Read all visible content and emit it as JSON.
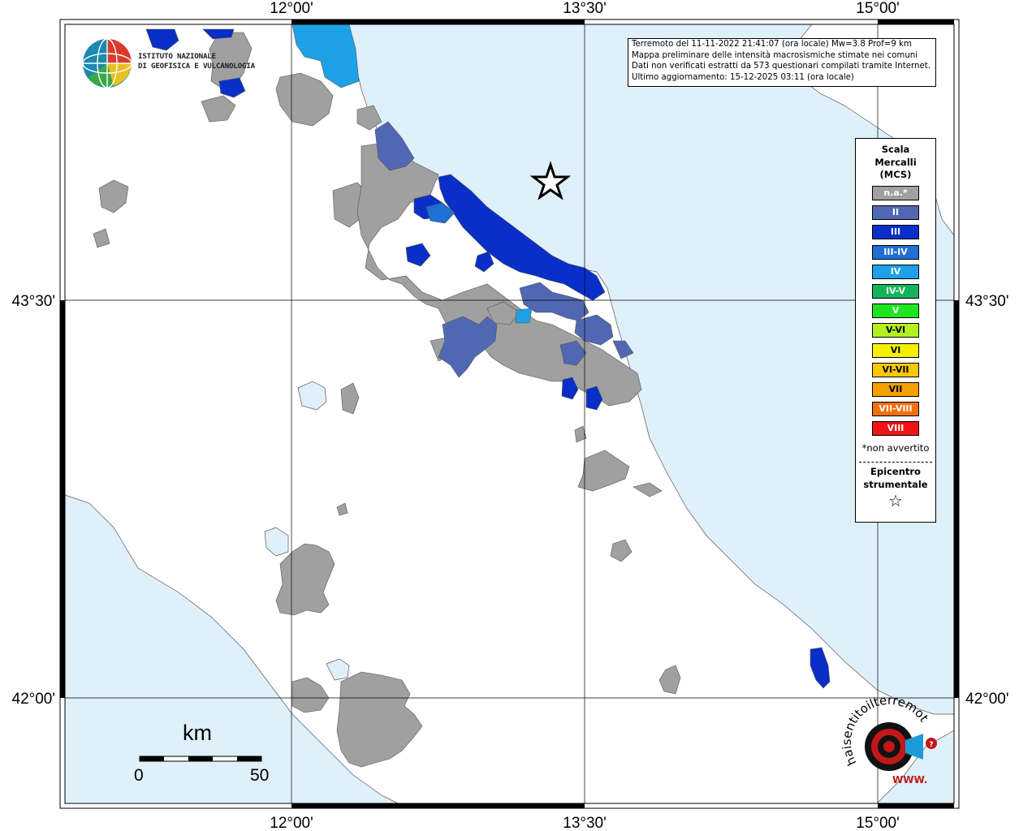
{
  "info": {
    "line1": "Terremoto del 11-11-2022 21:41:07 (ora locale) Mw=3.8 Prof=9 km",
    "line2": "Mappa preliminare delle intensità macrosismiche stimate nei comuni",
    "line3": "Dati non verificati estratti da 573 questionari compilati tramite Internet.",
    "line4": "Ultimo aggiornamento: 15-12-2025 03:11 (ora locale)"
  },
  "logo": {
    "line1": "ISTITUTO NAZIONALE",
    "line2": "DI GEOFISICA E VULCANOLOGIA"
  },
  "axes": {
    "top": [
      "12°00'",
      "13°30'",
      "15°00'"
    ],
    "bottom": [
      "12°00'",
      "13°30'",
      "15°00'"
    ],
    "left": [
      "43°30'",
      "42°00'"
    ],
    "right": [
      "43°30'",
      "42°00'"
    ]
  },
  "legend": {
    "title_line1": "Scala",
    "title_line2": "Mercalli",
    "title_line3": "(MCS)",
    "items": [
      {
        "label": "n.a.*",
        "color": "#a0a0a0"
      },
      {
        "label": "II",
        "color": "#5068b4"
      },
      {
        "label": "III",
        "color": "#0a2fc8"
      },
      {
        "label": "III-IV",
        "color": "#1f6fd4"
      },
      {
        "label": "IV",
        "color": "#1ea0e6"
      },
      {
        "label": "IV-V",
        "color": "#14b45a"
      },
      {
        "label": "V",
        "color": "#1ee61e"
      },
      {
        "label": "V-VI",
        "color": "#b4f01e"
      },
      {
        "label": "VI",
        "color": "#f5f000"
      },
      {
        "label": "VI-VII",
        "color": "#f5c800"
      },
      {
        "label": "VII",
        "color": "#f5a000"
      },
      {
        "label": "VII-VIII",
        "color": "#f56e0a"
      },
      {
        "label": "VIII",
        "color": "#f01414"
      }
    ],
    "note": "*non avvertito",
    "epicenter_line1": "Epicentro",
    "epicenter_line2": "strumentale",
    "epicenter_symbol": "☆"
  },
  "scale": {
    "unit": "km",
    "min": "0",
    "max": "50"
  },
  "badge": {
    "text": "haisentitoilterremoto.it",
    "www": "WWW."
  },
  "colors": {
    "sea": "#dff0fb",
    "land": "#ffffff",
    "na": "#a0a0a0",
    "ii": "#5068b4",
    "iii": "#0a2fc8",
    "iv": "#1ea0e6"
  }
}
